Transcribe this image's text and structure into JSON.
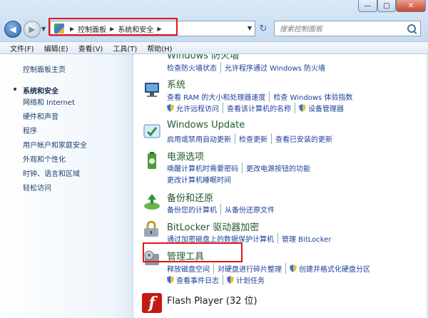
{
  "window": {
    "minimize_glyph": "—",
    "maximize_glyph": "□",
    "close_glyph": "✕"
  },
  "address": {
    "crumbs": [
      "控制面板",
      "系统和安全"
    ],
    "search_placeholder": "搜索控制面板"
  },
  "menu": [
    "文件(F)",
    "编辑(E)",
    "查看(V)",
    "工具(T)",
    "帮助(H)"
  ],
  "left_pane": {
    "home": "控制面板主页",
    "current": "系统和安全",
    "items": [
      "网络和 Internet",
      "硬件和声音",
      "程序",
      "用户帐户和家庭安全",
      "外观和个性化",
      "时钟、语言和区域",
      "轻松访问"
    ]
  },
  "sections": {
    "firewall": {
      "title": "Windows 防火墙",
      "links": [
        "检查防火墙状态",
        "允许程序通过 Windows 防火墙"
      ]
    },
    "system": {
      "title": "系统",
      "links": [
        "查看 RAM 的大小和处理器速度",
        "检查 Windows 体验指数",
        "允许远程访问",
        "查看该计算机的名称",
        "设备管理器"
      ]
    },
    "update": {
      "title": "Windows Update",
      "links": [
        "启用或禁用自动更新",
        "检查更新",
        "查看已安装的更新"
      ]
    },
    "power": {
      "title": "电源选项",
      "links": [
        "唤醒计算机时需要密码",
        "更改电源按钮的功能",
        "更改计算机睡眠时间"
      ]
    },
    "backup": {
      "title": "备份和还原",
      "links": [
        "备份您的计算机",
        "从备份还原文件"
      ]
    },
    "bitlocker": {
      "title": "BitLocker 驱动器加密",
      "links": [
        "通过加密磁盘上的数据保护计算机",
        "管理 BitLocker"
      ]
    },
    "admin": {
      "title": "管理工具",
      "links": [
        "释放磁盘空间",
        "对硬盘进行碎片整理",
        "创建并格式化硬盘分区",
        "查看事件日志",
        "计划任务"
      ]
    },
    "flash": {
      "title": "Flash Player (32 位)",
      "icon_glyph": "f"
    }
  },
  "colors": {
    "highlight_red": "#e01818",
    "link_blue": "#1d3f9a",
    "title_green": "#1f5a2e"
  },
  "icons": [
    "control-panel-icon",
    "search-icon",
    "shield-icon",
    "system-icon",
    "update-icon",
    "power-icon",
    "backup-icon",
    "bitlocker-icon",
    "admin-tools-icon",
    "flash-icon"
  ]
}
